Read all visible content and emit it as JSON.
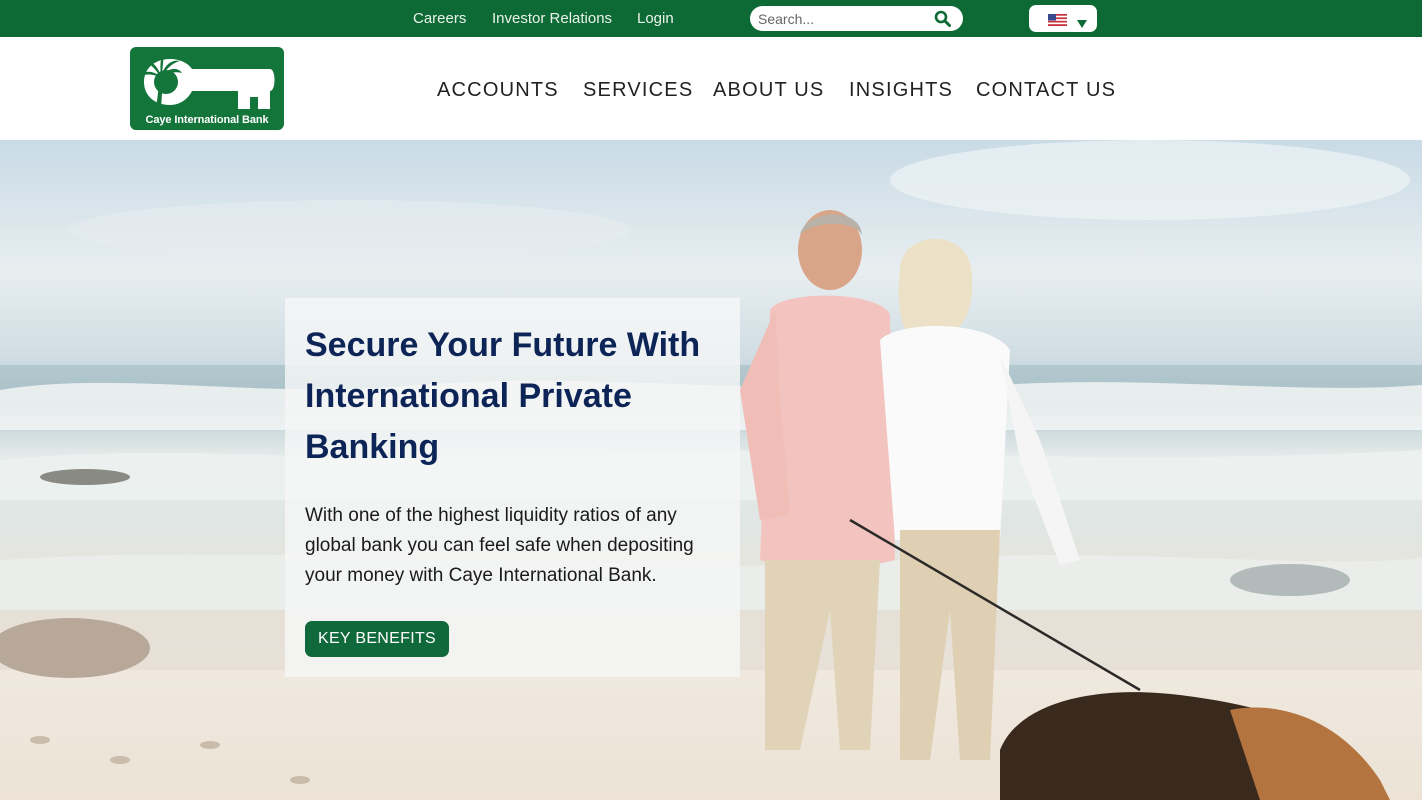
{
  "topbar": {
    "links": [
      "Careers",
      "Investor Relations",
      "Login"
    ],
    "search_placeholder": "Search...",
    "search_icon": "search-icon",
    "language": {
      "icon": "us-flag-icon",
      "caret_icon": "chevron-down-icon"
    },
    "bg_color": "#0e6a35"
  },
  "header": {
    "logo_text": "Caye International Bank",
    "logo_icons": [
      "palm-tree-icon",
      "key-icon"
    ],
    "nav": [
      "ACCOUNTS",
      "SERVICES",
      "ABOUT US",
      "INSIGHTS",
      "CONTACT US"
    ]
  },
  "hero": {
    "title": "Secure Your Future With International Private Banking",
    "description": "With one of the highest liquidity ratios of any global bank you can feel safe when depositing your money with Caye International Bank.",
    "button_label": "KEY BENEFITS",
    "title_color": "#0d2457",
    "button_color": "#10693a"
  }
}
